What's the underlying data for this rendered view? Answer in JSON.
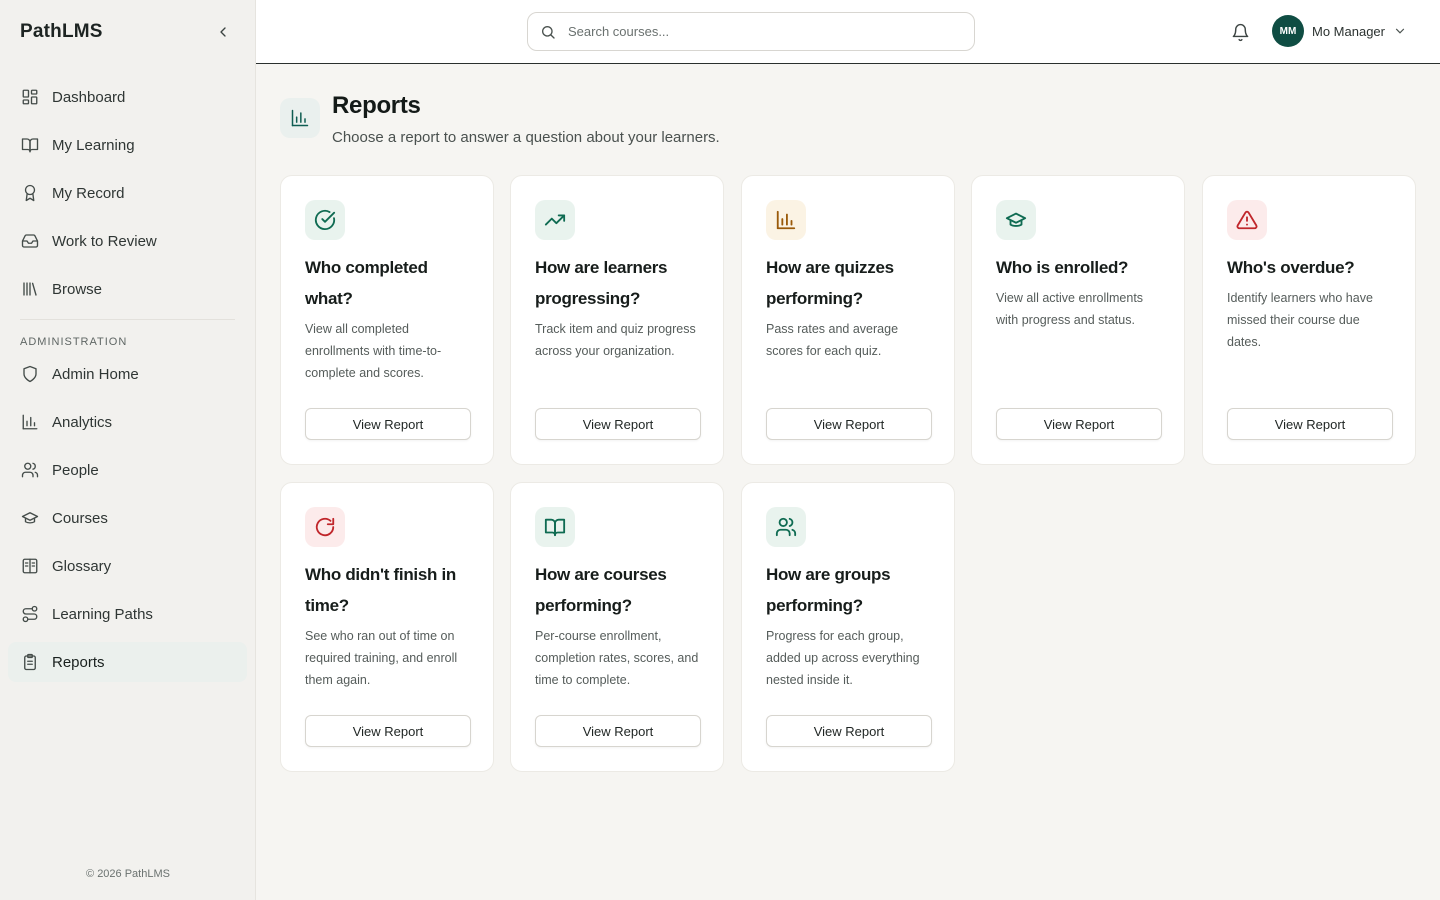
{
  "app": {
    "brand": "PathLMS"
  },
  "sidebar": {
    "items": [
      {
        "label": "Dashboard",
        "icon": "dashboard-icon"
      },
      {
        "label": "My Learning",
        "icon": "book-open-icon"
      },
      {
        "label": "My Record",
        "icon": "award-icon"
      },
      {
        "label": "Work to Review",
        "icon": "inbox-icon"
      },
      {
        "label": "Browse",
        "icon": "library-icon"
      }
    ],
    "section_label": "ADMINISTRATION",
    "admin_items": [
      {
        "label": "Admin Home",
        "icon": "shield-icon"
      },
      {
        "label": "Analytics",
        "icon": "bar-chart-icon"
      },
      {
        "label": "People",
        "icon": "users-icon"
      },
      {
        "label": "Courses",
        "icon": "graduation-cap-icon"
      },
      {
        "label": "Glossary",
        "icon": "book-text-icon"
      },
      {
        "label": "Learning Paths",
        "icon": "route-icon"
      },
      {
        "label": "Reports",
        "icon": "clipboard-list-icon",
        "active": true
      }
    ],
    "copyright": "© 2026 PathLMS"
  },
  "topbar": {
    "search_placeholder": "Search courses...",
    "user_initials": "MM",
    "user_name": "Mo Manager"
  },
  "page": {
    "title": "Reports",
    "subtitle": "Choose a report to answer a question about your learners."
  },
  "colors": {
    "accent": "#0f4d43",
    "green_icon": "#0f6b52",
    "amber_icon": "#9a5a0a",
    "red_icon": "#c0262b"
  },
  "reports": [
    {
      "title": "Who completed what?",
      "desc": "View all completed enrollments with time-to-complete and scores.",
      "button": "View Report",
      "icon": "check-circle-icon"
    },
    {
      "title": "How are learners progressing?",
      "desc": "Track item and quiz progress across your organization.",
      "button": "View Report",
      "icon": "trending-up-icon"
    },
    {
      "title": "How are quizzes performing?",
      "desc": "Pass rates and average scores for each quiz.",
      "button": "View Report",
      "icon": "bar-chart-icon"
    },
    {
      "title": "Who is enrolled?",
      "desc": "View all active enrollments with progress and status.",
      "button": "View Report",
      "icon": "graduation-cap-icon"
    },
    {
      "title": "Who's overdue?",
      "desc": "Identify learners who have missed their course due dates.",
      "button": "View Report",
      "icon": "alert-triangle-icon"
    },
    {
      "title": "Who didn't finish in time?",
      "desc": "See who ran out of time on required training, and enroll them again.",
      "button": "View Report",
      "icon": "rotate-icon"
    },
    {
      "title": "How are courses performing?",
      "desc": "Per-course enrollment, completion rates, scores, and time to complete.",
      "button": "View Report",
      "icon": "book-open-icon"
    },
    {
      "title": "How are groups performing?",
      "desc": "Progress for each group, added up across everything nested inside it.",
      "button": "View Report",
      "icon": "users-icon"
    }
  ]
}
